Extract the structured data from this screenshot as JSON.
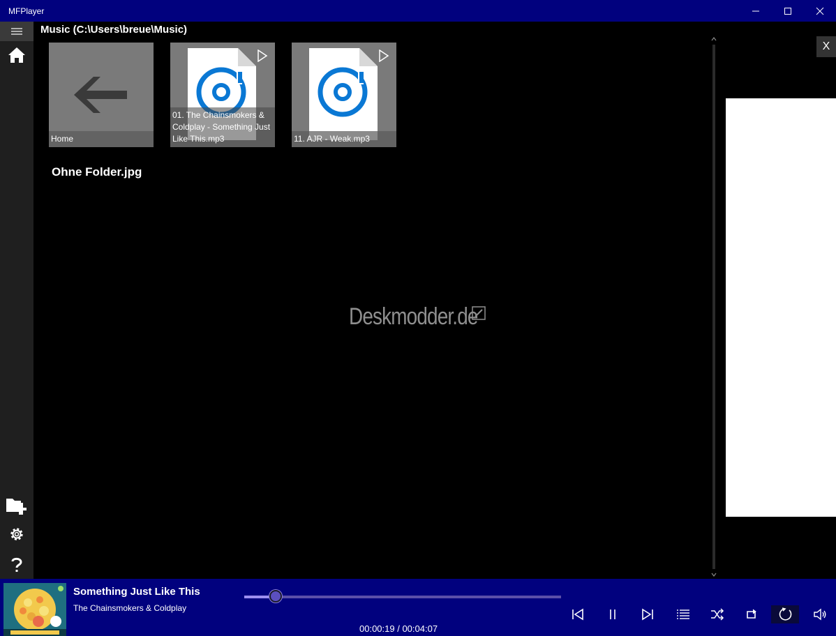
{
  "window": {
    "title": "MFPlayer"
  },
  "main": {
    "path_title": "Music (C:\\Users\\breue\\Music)",
    "tiles": [
      {
        "label": "Home"
      },
      {
        "label": "01. The Chainsmokers & Coldplay - Something Just Like This.mp3"
      },
      {
        "label": "11. AJR - Weak.mp3"
      }
    ],
    "section_title": "Ohne Folder.jpg",
    "watermark": "Deskmodder.de"
  },
  "right_panel": {
    "close_label": "X"
  },
  "player": {
    "track_title": "Something Just Like This",
    "track_artist": "The Chainsmokers & Coldplay",
    "time_text": "00:00:19 / 00:04:07",
    "progress": 0.1,
    "accent_color": "#01017e",
    "progress_color": "#5a4fa8"
  },
  "icons": {
    "sidebar": [
      "hamburger-icon",
      "home-icon",
      "add-folder-icon",
      "gear-icon",
      "help-icon"
    ],
    "controls": [
      "previous-icon",
      "pause-icon",
      "next-icon",
      "playlist-icon",
      "shuffle-icon",
      "repeat-icon",
      "refresh-icon",
      "volume-icon"
    ]
  }
}
